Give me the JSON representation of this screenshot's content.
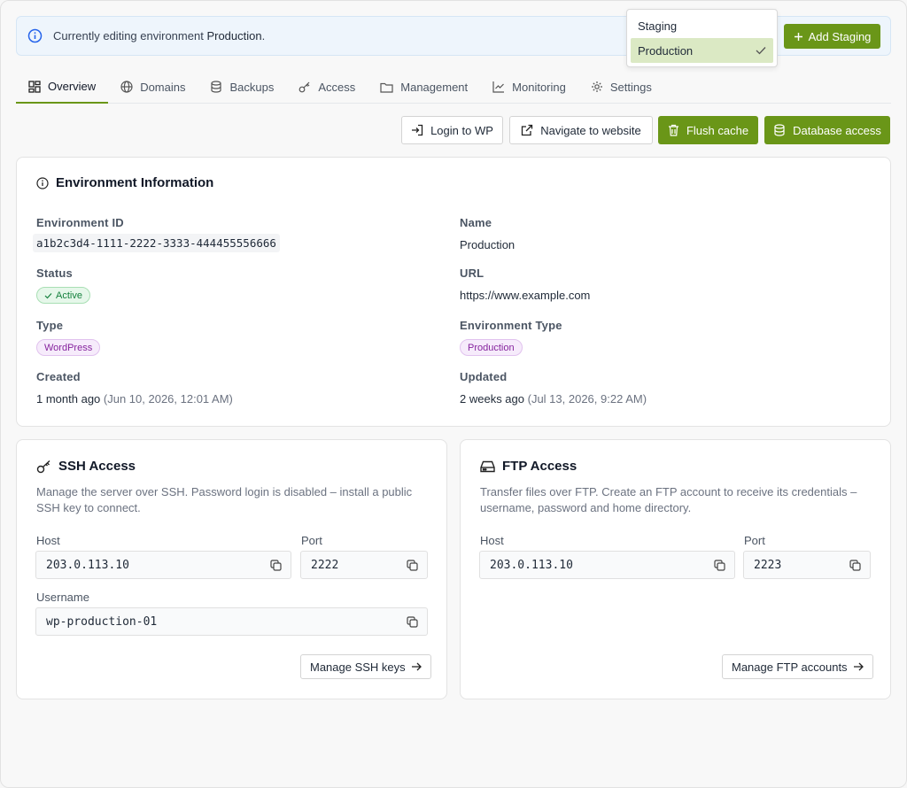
{
  "banner": {
    "text_prefix": "Currently editing environment",
    "env_name": "Production"
  },
  "env_switcher": {
    "options": [
      {
        "label": "Staging",
        "selected": false
      },
      {
        "label": "Production",
        "selected": true
      }
    ]
  },
  "add_staging_label": "Add Staging",
  "tabs": [
    {
      "label": "Overview",
      "icon": "grid-icon",
      "active": true
    },
    {
      "label": "Domains",
      "icon": "globe-icon",
      "active": false
    },
    {
      "label": "Backups",
      "icon": "database-icon",
      "active": false
    },
    {
      "label": "Access",
      "icon": "key-icon",
      "active": false
    },
    {
      "label": "Management",
      "icon": "folder-icon",
      "active": false
    },
    {
      "label": "Monitoring",
      "icon": "chart-icon",
      "active": false
    },
    {
      "label": "Settings",
      "icon": "gear-icon",
      "active": false
    }
  ],
  "actions": {
    "login_wp": "Login to WP",
    "navigate": "Navigate to website",
    "flush_cache": "Flush cache",
    "db_access": "Database access"
  },
  "env_info": {
    "title": "Environment Information",
    "env_id_label": "Environment ID",
    "env_id": "a1b2c3d4-1111-2222-3333-444455556666",
    "name_label": "Name",
    "name": "Production",
    "status_label": "Status",
    "status": "Active",
    "url_label": "URL",
    "url": "https://www.example.com",
    "type_label": "Type",
    "type": "WordPress",
    "env_type_label": "Environment Type",
    "env_type": "Production",
    "created_label": "Created",
    "created_rel": "1 month ago",
    "created_abs": "(Jun 10, 2026, 12:01 AM)",
    "updated_label": "Updated",
    "updated_rel": "2 weeks ago",
    "updated_abs": "(Jul 13, 2026, 9:22 AM)"
  },
  "ssh": {
    "title": "SSH Access",
    "desc_line1": "Manage the server over SSH. Password login is disabled – install a public",
    "desc_line2": "SSH key to connect.",
    "host_label": "Host",
    "host": "203.0.113.10",
    "port_label": "Port",
    "port": "2222",
    "username_label": "Username",
    "username": "wp-production-01",
    "manage_label": "Manage SSH keys"
  },
  "ftp": {
    "title": "FTP Access",
    "desc_line1": "Transfer files over FTP. Create an FTP account to receive its credentials –",
    "desc_line2": "username, password and home directory.",
    "host_label": "Host",
    "host": "203.0.113.10",
    "port_label": "Port",
    "port": "2223",
    "manage_label": "Manage FTP accounts"
  },
  "colors": {
    "accent_green": "#6a9618",
    "selected_option_bg": "#dbe9c4",
    "banner_bg": "#eef5fc"
  }
}
